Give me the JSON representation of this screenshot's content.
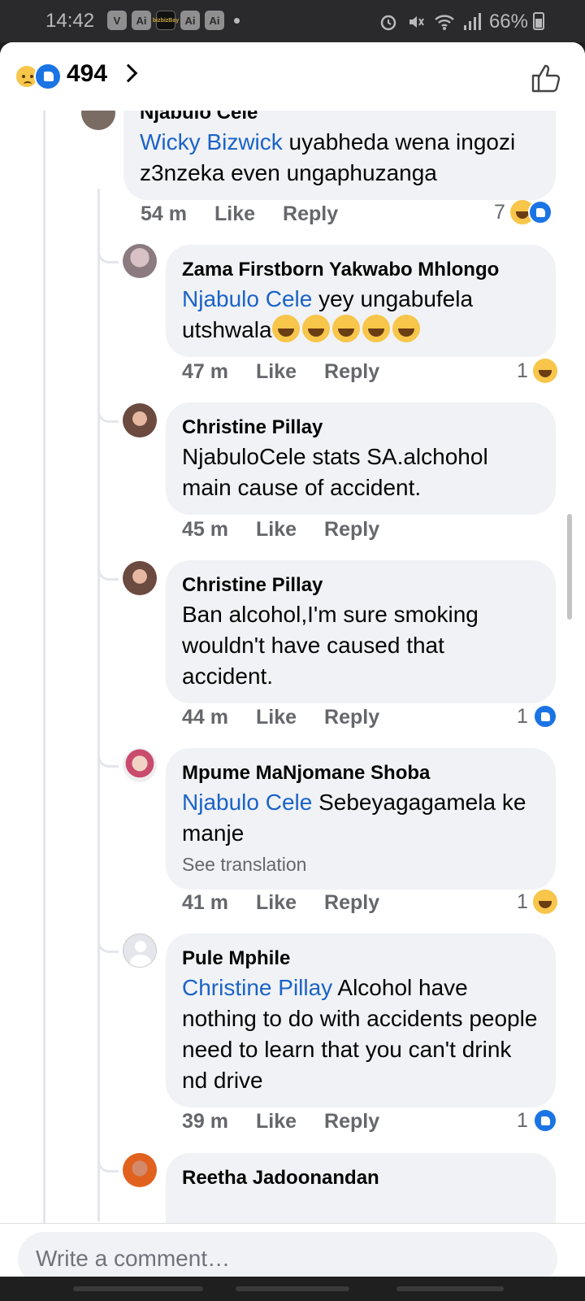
{
  "status_bar": {
    "time": "14:42",
    "app_icons": [
      "V",
      "Ai",
      "bizbizBay",
      "Ai",
      "Ai"
    ],
    "battery": "66%"
  },
  "header": {
    "reaction_count": "494"
  },
  "comments": [
    {
      "name": "Njabulo Cele",
      "mention": "Wicky Bizwick",
      "text": " uyabheda wena ingozi z3nzeka even  ungaphuzanga",
      "time": "54 m",
      "like": "Like",
      "reply": "Reply",
      "reactions": "7",
      "reaction_types": [
        "haha",
        "like"
      ]
    },
    {
      "name": "Zama Firstborn Yakwabo Mhlongo",
      "mention": "Njabulo Cele",
      "text": " yey ungabufela utshwala",
      "emoji_count": 5,
      "time": "47 m",
      "like": "Like",
      "reply": "Reply",
      "reactions": "1",
      "reaction_types": [
        "haha"
      ]
    },
    {
      "name": "Christine Pillay",
      "text": "NjabuloCele stats SA.alchohol main cause of accident.",
      "time": "45 m",
      "like": "Like",
      "reply": "Reply"
    },
    {
      "name": "Christine Pillay",
      "text": "Ban alcohol,I'm sure smoking wouldn't have caused that accident.",
      "time": "44 m",
      "like": "Like",
      "reply": "Reply",
      "reactions": "1",
      "reaction_types": [
        "like"
      ]
    },
    {
      "name": "Mpume MaNjomane Shoba",
      "mention": "Njabulo Cele",
      "text": " Sebeyagagamela ke manje",
      "translate": "See translation",
      "time": "41 m",
      "like": "Like",
      "reply": "Reply",
      "reactions": "1",
      "reaction_types": [
        "haha"
      ]
    },
    {
      "name": "Pule Mphile",
      "mention": "Christine Pillay",
      "text": " Alcohol have nothing to do with accidents people need to learn that you can't drink nd drive",
      "time": "39 m",
      "like": "Like",
      "reply": "Reply",
      "reactions": "1",
      "reaction_types": [
        "like"
      ]
    },
    {
      "name": "Reetha Jadoonandan"
    }
  ],
  "composer": {
    "placeholder": "Write a comment…"
  },
  "colors": {
    "mention": "#1b63c7",
    "bubble": "#f0f2f5",
    "like_blue": "#1b74e4"
  }
}
